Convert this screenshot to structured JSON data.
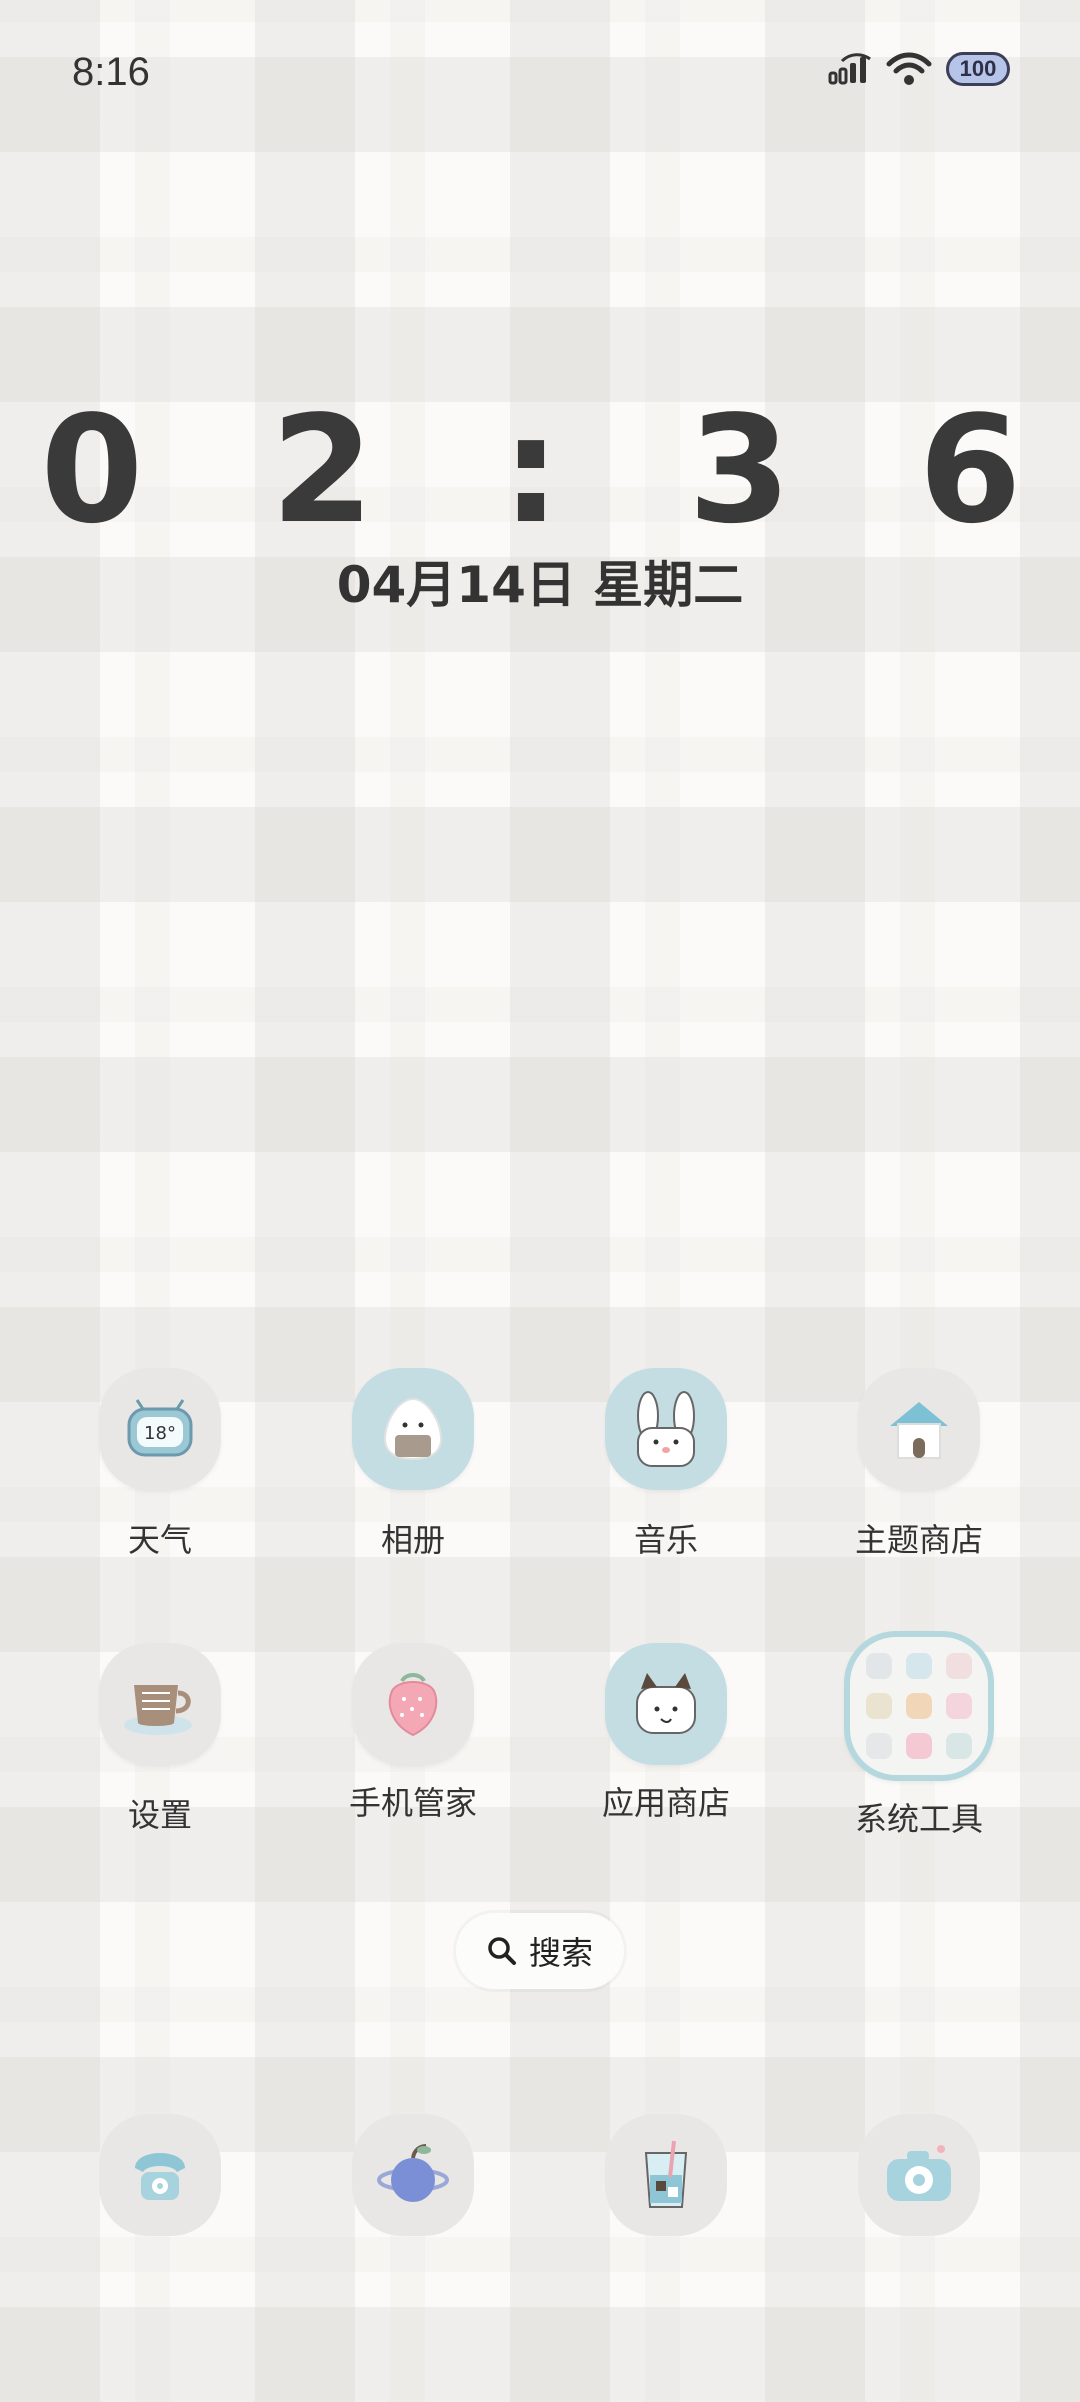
{
  "status_bar": {
    "time": "8:16",
    "battery": "100",
    "icons": [
      "signal-icon",
      "wifi-icon",
      "battery-icon"
    ]
  },
  "clock_widget": {
    "time": "0 2 : 3 6",
    "date": "04月14日 星期二"
  },
  "apps": [
    {
      "label": "天气",
      "icon": "weather-icon"
    },
    {
      "label": "相册",
      "icon": "gallery-icon"
    },
    {
      "label": "音乐",
      "icon": "music-icon"
    },
    {
      "label": "主题商店",
      "icon": "theme-store-icon"
    },
    {
      "label": "设置",
      "icon": "settings-icon"
    },
    {
      "label": "手机管家",
      "icon": "phone-manager-icon"
    },
    {
      "label": "应用商店",
      "icon": "app-store-icon"
    },
    {
      "label": "系统工具",
      "icon": "system-tools-folder-icon"
    }
  ],
  "search": {
    "label": "搜索"
  },
  "dock": [
    {
      "icon": "phone-icon"
    },
    {
      "icon": "browser-icon"
    },
    {
      "icon": "messages-icon"
    },
    {
      "icon": "camera-icon"
    }
  ],
  "colors": {
    "accent_blue": "#c3dde3",
    "icon_gray": "#e9e7e5",
    "battery_fill": "#b7c4e9"
  }
}
